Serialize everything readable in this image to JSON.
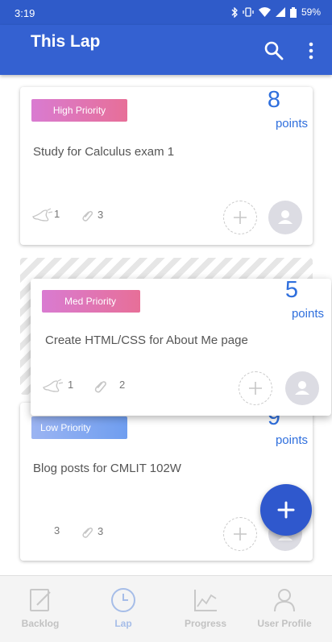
{
  "status_bar": {
    "time": "3:19",
    "battery": "59%",
    "icons": [
      "bluetooth-icon",
      "vibrate-icon",
      "wifi-icon",
      "signal-icon",
      "battery-icon"
    ]
  },
  "app_bar": {
    "title": "This Lap",
    "actions": [
      "search-icon",
      "more-vertical-icon"
    ]
  },
  "cards": [
    {
      "priority": "High Priority",
      "points": "8",
      "points_label": "points",
      "title": "Study for Calculus exam 1",
      "stat1": "1",
      "stat2": "3",
      "stat1_icon": "foot-icon",
      "stat2_icon": "paperclip-icon"
    },
    {
      "priority": "Med Priority",
      "points": "5",
      "points_label": "points",
      "title": "Create HTML/CSS for About Me page",
      "stat1": "1",
      "stat2": "2",
      "stat1_icon": "foot-icon",
      "stat2_icon": "paperclip-icon"
    },
    {
      "priority": "Low Priority",
      "points": "9",
      "points_label": "points",
      "title": "Blog posts for CMLIT 102W",
      "stat1": "3",
      "stat2": "3",
      "stat2_icon": "paperclip-icon"
    }
  ],
  "colors": {
    "primary": "#3461d1",
    "status_bar": "#2f5bc9",
    "points": "#2f6fdd",
    "high_priority": [
      "#d97bd1",
      "#e76f98"
    ],
    "med_priority": [
      "#d97bd1",
      "#e76f98"
    ],
    "low_priority": [
      "#9bb4f2",
      "#6f9ef0"
    ],
    "fab": "#2f58cd"
  },
  "fab": {
    "icon": "plus-icon"
  },
  "bottom_nav": {
    "items": [
      {
        "label": "Backlog",
        "icon": "edit-icon"
      },
      {
        "label": "Lap",
        "icon": "clock-icon"
      },
      {
        "label": "Progress",
        "icon": "chart-icon"
      },
      {
        "label": "User Profile",
        "icon": "user-icon"
      }
    ],
    "active": "Lap"
  }
}
